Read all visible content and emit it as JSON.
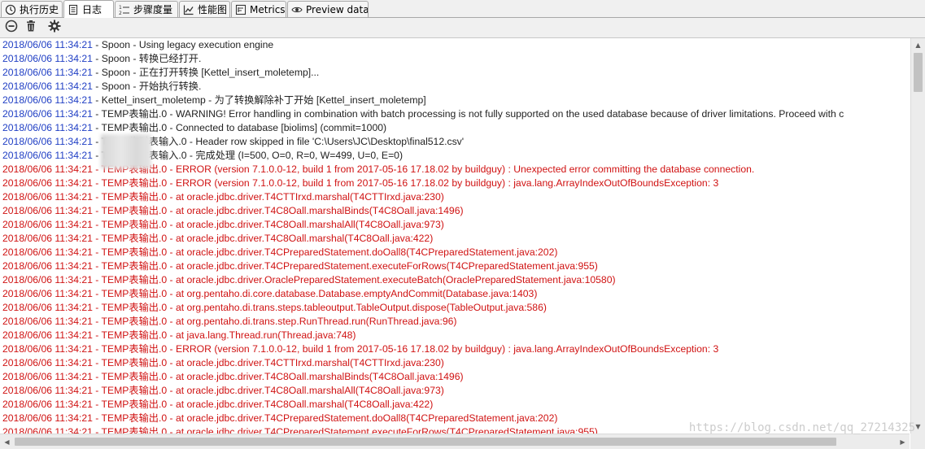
{
  "tabs": [
    {
      "label": "执行历史",
      "icon": "history-icon",
      "active": false
    },
    {
      "label": "日志",
      "icon": "log-icon",
      "active": true
    },
    {
      "label": "步骤度量",
      "icon": "step-metrics-icon",
      "active": false
    },
    {
      "label": "性能图",
      "icon": "performance-chart-icon",
      "active": false
    },
    {
      "label": "Metrics",
      "icon": "metrics-icon",
      "active": false
    },
    {
      "label": "Preview data",
      "icon": "preview-eye-icon",
      "active": false
    }
  ],
  "toolbar": {
    "buttons": [
      {
        "icon": "stop-icon"
      },
      {
        "icon": "trash-icon"
      },
      {
        "icon": "gear-icon"
      }
    ]
  },
  "log": {
    "lines": [
      {
        "ts": "2018/06/06 11:34:21",
        "msg": " - Spoon - Using legacy execution engine",
        "level": "info"
      },
      {
        "ts": "2018/06/06 11:34:21",
        "msg": " - Spoon - 转换已经打开.",
        "level": "info"
      },
      {
        "ts": "2018/06/06 11:34:21",
        "msg": " - Spoon - 正在打开转换 [Kettel_insert_moletemp]...",
        "level": "info"
      },
      {
        "ts": "2018/06/06 11:34:21",
        "msg": " - Spoon - 开始执行转换.",
        "level": "info"
      },
      {
        "ts": "2018/06/06 11:34:21",
        "msg": " - Kettel_insert_moletemp - 为了转换解除补丁开始  [Kettel_insert_moletemp]",
        "level": "info"
      },
      {
        "ts": "2018/06/06 11:34:21",
        "msg": " - TEMP表输出.0 - WARNING! Error handling in combination with batch processing is not fully supported on the used database because of driver limitations. Proceed with c",
        "level": "info"
      },
      {
        "ts": "2018/06/06 11:34:21",
        "msg": " - TEMP表输出.0 - Connected to database [biolims] (commit=1000)",
        "level": "info"
      },
      {
        "ts": "2018/06/06 11:34:21",
        "msg": " - TEMP临时表输入.0 - Header row skipped in file 'C:\\Users\\JC\\Desktop\\final512.csv'",
        "level": "info"
      },
      {
        "ts": "2018/06/06 11:34:21",
        "msg": " - TEMP临时表输入.0 - 完成处理 (I=500, O=0, R=0, W=499, U=0, E=0)",
        "level": "info"
      },
      {
        "ts": "2018/06/06 11:34:21",
        "msg": " - TEMP表输出.0 - ERROR (version 7.1.0.0-12, build 1 from 2017-05-16 17.18.02 by buildguy) : Unexpected error committing the database connection.",
        "level": "error"
      },
      {
        "ts": "2018/06/06 11:34:21",
        "msg": " - TEMP表输出.0 - ERROR (version 7.1.0.0-12, build 1 from 2017-05-16 17.18.02 by buildguy) : java.lang.ArrayIndexOutOfBoundsException: 3",
        "level": "error"
      },
      {
        "ts": "2018/06/06 11:34:21",
        "msg": " - TEMP表输出.0 - at oracle.jdbc.driver.T4CTTIrxd.marshal(T4CTTIrxd.java:230)",
        "level": "error"
      },
      {
        "ts": "2018/06/06 11:34:21",
        "msg": " - TEMP表输出.0 - at oracle.jdbc.driver.T4C8Oall.marshalBinds(T4C8Oall.java:1496)",
        "level": "error"
      },
      {
        "ts": "2018/06/06 11:34:21",
        "msg": " - TEMP表输出.0 - at oracle.jdbc.driver.T4C8Oall.marshalAll(T4C8Oall.java:973)",
        "level": "error"
      },
      {
        "ts": "2018/06/06 11:34:21",
        "msg": " - TEMP表输出.0 - at oracle.jdbc.driver.T4C8Oall.marshal(T4C8Oall.java:422)",
        "level": "error"
      },
      {
        "ts": "2018/06/06 11:34:21",
        "msg": " - TEMP表输出.0 - at oracle.jdbc.driver.T4CPreparedStatement.doOall8(T4CPreparedStatement.java:202)",
        "level": "error"
      },
      {
        "ts": "2018/06/06 11:34:21",
        "msg": " - TEMP表输出.0 - at oracle.jdbc.driver.T4CPreparedStatement.executeForRows(T4CPreparedStatement.java:955)",
        "level": "error"
      },
      {
        "ts": "2018/06/06 11:34:21",
        "msg": " - TEMP表输出.0 - at oracle.jdbc.driver.OraclePreparedStatement.executeBatch(OraclePreparedStatement.java:10580)",
        "level": "error"
      },
      {
        "ts": "2018/06/06 11:34:21",
        "msg": " - TEMP表输出.0 - at org.pentaho.di.core.database.Database.emptyAndCommit(Database.java:1403)",
        "level": "error"
      },
      {
        "ts": "2018/06/06 11:34:21",
        "msg": " - TEMP表输出.0 - at org.pentaho.di.trans.steps.tableoutput.TableOutput.dispose(TableOutput.java:586)",
        "level": "error"
      },
      {
        "ts": "2018/06/06 11:34:21",
        "msg": " - TEMP表输出.0 - at org.pentaho.di.trans.step.RunThread.run(RunThread.java:96)",
        "level": "error"
      },
      {
        "ts": "2018/06/06 11:34:21",
        "msg": " - TEMP表输出.0 - at java.lang.Thread.run(Thread.java:748)",
        "level": "error"
      },
      {
        "ts": "2018/06/06 11:34:21",
        "msg": " - TEMP表输出.0 - ERROR (version 7.1.0.0-12, build 1 from 2017-05-16 17.18.02 by buildguy) : java.lang.ArrayIndexOutOfBoundsException: 3",
        "level": "error"
      },
      {
        "ts": "2018/06/06 11:34:21",
        "msg": " - TEMP表输出.0 - at oracle.jdbc.driver.T4CTTIrxd.marshal(T4CTTIrxd.java:230)",
        "level": "error"
      },
      {
        "ts": "2018/06/06 11:34:21",
        "msg": " - TEMP表输出.0 - at oracle.jdbc.driver.T4C8Oall.marshalBinds(T4C8Oall.java:1496)",
        "level": "error"
      },
      {
        "ts": "2018/06/06 11:34:21",
        "msg": " - TEMP表输出.0 - at oracle.jdbc.driver.T4C8Oall.marshalAll(T4C8Oall.java:973)",
        "level": "error"
      },
      {
        "ts": "2018/06/06 11:34:21",
        "msg": " - TEMP表输出.0 - at oracle.jdbc.driver.T4C8Oall.marshal(T4C8Oall.java:422)",
        "level": "error"
      },
      {
        "ts": "2018/06/06 11:34:21",
        "msg": " - TEMP表输出.0 - at oracle.jdbc.driver.T4CPreparedStatement.doOall8(T4CPreparedStatement.java:202)",
        "level": "error"
      },
      {
        "ts": "2018/06/06 11:34:21",
        "msg": " - TEMP表输出.0 - at oracle.jdbc.driver.T4CPreparedStatement.executeForRows(T4CPreparedStatement.java:955)",
        "level": "error"
      }
    ]
  },
  "watermark": "https://blog.csdn.net/qq_27214325",
  "colors": {
    "timestamp": "#1f3ec4",
    "error": "#d01212",
    "text": "#222222"
  }
}
